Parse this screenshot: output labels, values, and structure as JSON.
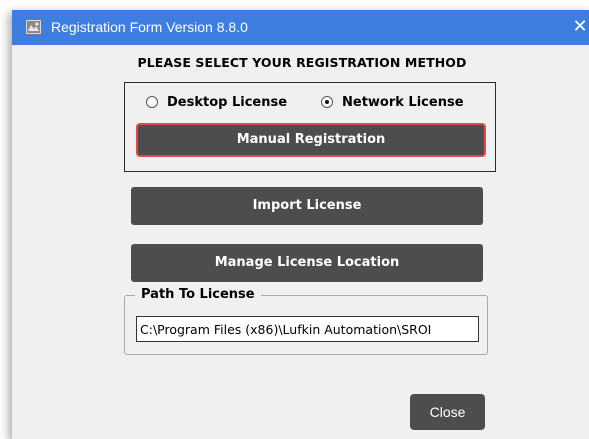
{
  "window": {
    "title": "Registration Form Version 8.8.0",
    "close_glyph": "✕",
    "app_icon": "registration-app-icon",
    "titlebar_color": "#3d7ee0"
  },
  "heading": "PLEASE SELECT YOUR REGISTRATION METHOD",
  "license_type": {
    "options": [
      {
        "label": "Desktop License",
        "selected": false
      },
      {
        "label": "Network License",
        "selected": true
      }
    ]
  },
  "buttons": {
    "manual_registration": "Manual Registration",
    "import_license": "Import License",
    "manage_license_location": "Manage License Location",
    "close": "Close"
  },
  "path_to_license": {
    "label": "Path To License",
    "value": "C:\\Program Files (x86)\\Lufkin Automation\\SROI"
  },
  "colors": {
    "button_bg": "#4d4d4d",
    "highlight_border": "#e24a4a"
  }
}
